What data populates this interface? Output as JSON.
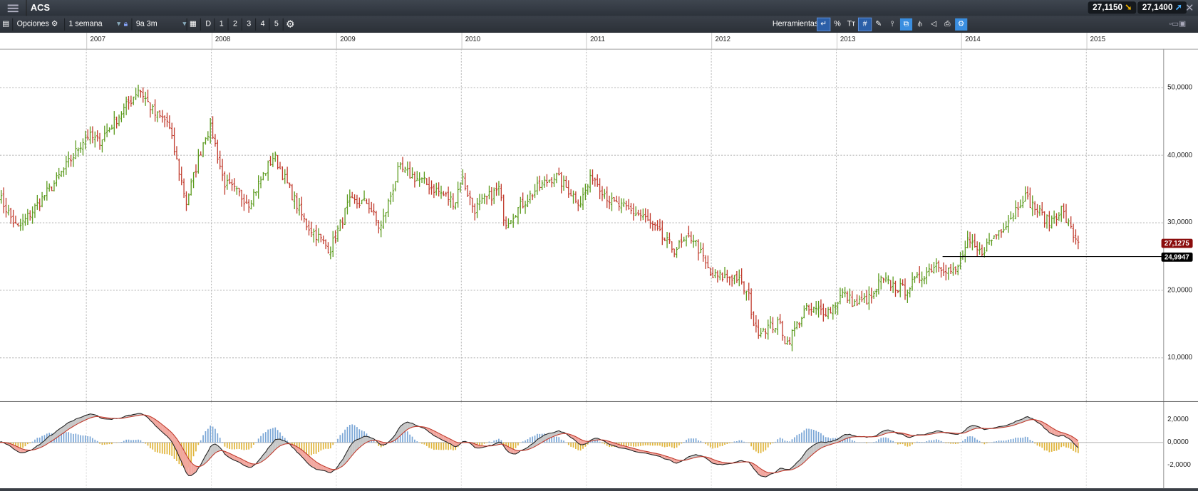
{
  "header": {
    "title": "ACS",
    "quote_bid": "27,1150",
    "quote_ask": "27,1400"
  },
  "toolbar": {
    "options_label": "Opciones",
    "interval": "1 semana",
    "range": "9a 3m",
    "day_label": "D",
    "presets": [
      "1",
      "2",
      "3",
      "4",
      "5"
    ],
    "tools_label": "Herramientas",
    "percent": "%",
    "text_tool": "Tт"
  },
  "colors": {
    "up": "#5a9a1c",
    "down": "#c0392b",
    "last_price_bg": "#8b0d0d",
    "ref_bg": "#000000",
    "macd_fill_pos": "#c8c8c8",
    "macd_fill_neg": "#f2a8a0",
    "hist_pos": "#7aa6d6",
    "hist_neg": "#e0b43a"
  },
  "chart_data": {
    "type": "ohlc",
    "symbol": "ACS",
    "interval": "weekly",
    "x_tick_labels": [
      "2007",
      "2008",
      "2009",
      "2010",
      "2011",
      "2012",
      "2013",
      "2014",
      "2015"
    ],
    "y_tick_labels": [
      "50,0000",
      "40,0000",
      "30,0000",
      "20,0000",
      "10,0000"
    ],
    "y_ticks": [
      50,
      40,
      30,
      20,
      10
    ],
    "ylim": [
      5,
      57
    ],
    "last_price": "27,1275",
    "reference_line": "24,9947",
    "reference_value": 24.9947,
    "approx_close_path": [
      [
        2006.3,
        34
      ],
      [
        2006.45,
        29
      ],
      [
        2006.75,
        36
      ],
      [
        2006.9,
        40
      ],
      [
        2007.0,
        43
      ],
      [
        2007.1,
        42
      ],
      [
        2007.35,
        48
      ],
      [
        2007.42,
        50
      ],
      [
        2007.55,
        46
      ],
      [
        2007.65,
        45
      ],
      [
        2007.8,
        33
      ],
      [
        2007.95,
        43
      ],
      [
        2008.0,
        44
      ],
      [
        2008.1,
        36
      ],
      [
        2008.3,
        33
      ],
      [
        2008.5,
        40
      ],
      [
        2008.6,
        36
      ],
      [
        2008.75,
        30
      ],
      [
        2008.95,
        26
      ],
      [
        2009.1,
        33
      ],
      [
        2009.25,
        33
      ],
      [
        2009.35,
        29
      ],
      [
        2009.5,
        38
      ],
      [
        2009.7,
        36
      ],
      [
        2009.95,
        33
      ],
      [
        2010.0,
        37
      ],
      [
        2010.1,
        32
      ],
      [
        2010.3,
        35
      ],
      [
        2010.35,
        30
      ],
      [
        2010.6,
        35
      ],
      [
        2010.75,
        37
      ],
      [
        2010.95,
        33
      ],
      [
        2011.05,
        37
      ],
      [
        2011.2,
        33
      ],
      [
        2011.45,
        31
      ],
      [
        2011.7,
        26
      ],
      [
        2011.85,
        28
      ],
      [
        2012.0,
        22
      ],
      [
        2012.2,
        22
      ],
      [
        2012.3,
        19
      ],
      [
        2012.35,
        14
      ],
      [
        2012.55,
        15
      ],
      [
        2012.6,
        12
      ],
      [
        2012.75,
        17
      ],
      [
        2012.95,
        17
      ],
      [
        2013.05,
        19.5
      ],
      [
        2013.15,
        18
      ],
      [
        2013.3,
        19
      ],
      [
        2013.35,
        21.5
      ],
      [
        2013.55,
        20
      ],
      [
        2013.8,
        24
      ],
      [
        2013.95,
        22.5
      ],
      [
        2014.05,
        27
      ],
      [
        2014.15,
        25.5
      ],
      [
        2014.4,
        31
      ],
      [
        2014.5,
        34
      ],
      [
        2014.6,
        32
      ],
      [
        2014.7,
        30
      ],
      [
        2014.8,
        32
      ],
      [
        2014.9,
        28
      ],
      [
        2014.94,
        27.1
      ]
    ],
    "macd": {
      "y_tick_labels": [
        "2,0000",
        "0,0000",
        "-2,0000"
      ],
      "y_ticks": [
        2,
        0,
        -2
      ],
      "params": [
        12,
        26,
        9
      ]
    }
  }
}
